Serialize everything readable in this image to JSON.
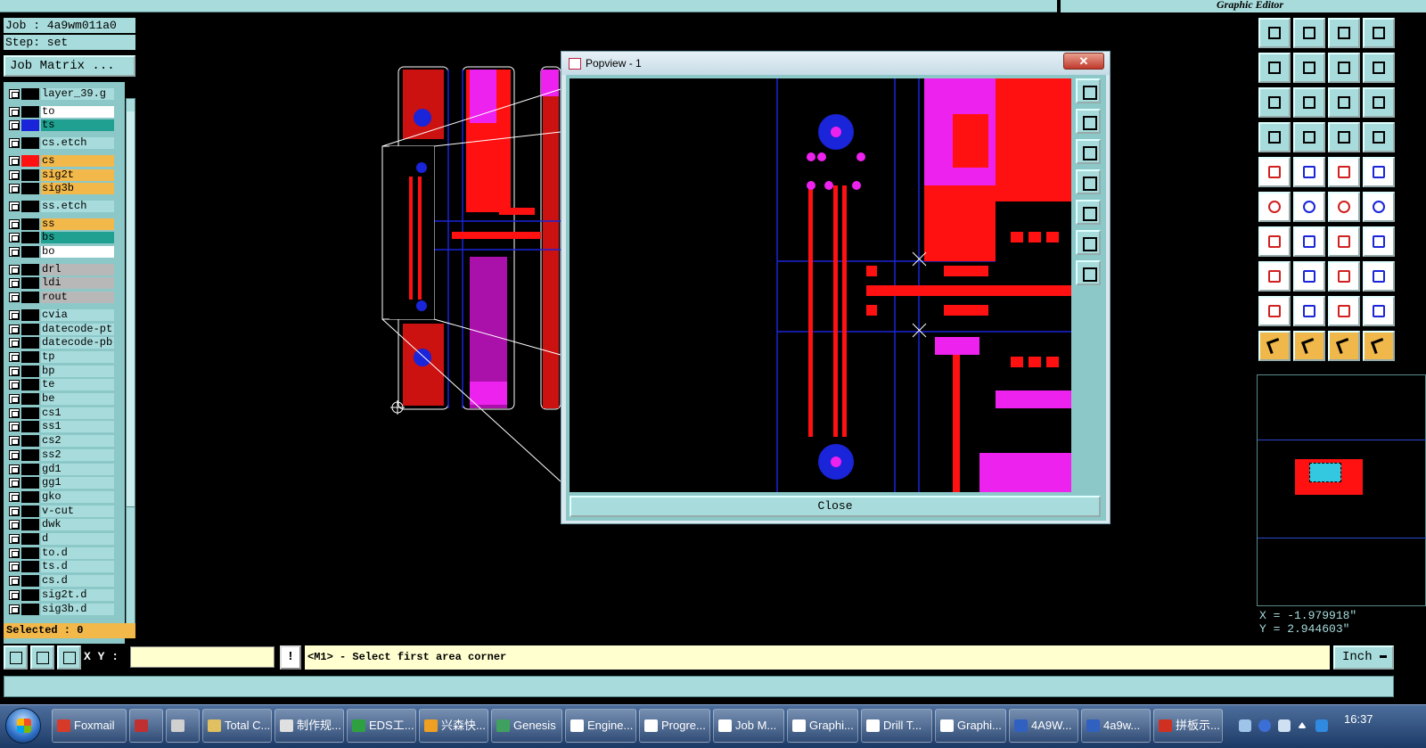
{
  "title_right": "Graphic Editor",
  "job_line": "Job : 4a9wm011a0",
  "step_line": "Step: set",
  "job_matrix_label": "Job Matrix ...",
  "layers": [
    {
      "name": "layer_39.g",
      "color": "#000000",
      "text_bg": "#a8dcdc"
    },
    {
      "name": "to",
      "color": "#000000",
      "text_bg": "#ffffff"
    },
    {
      "name": "ts",
      "color": "#1a24d8",
      "text_bg": "#1fa090"
    },
    {
      "name": "cs.etch",
      "color": "#000000",
      "text_bg": "#a8dcdc"
    },
    {
      "name": "cs",
      "color": "#ff1111",
      "text_bg": "#f2b84a"
    },
    {
      "name": "sig2t",
      "color": "#000000",
      "text_bg": "#f2b84a"
    },
    {
      "name": "sig3b",
      "color": "#000000",
      "text_bg": "#f2b84a"
    },
    {
      "name": "ss.etch",
      "color": "#000000",
      "text_bg": "#a8dcdc"
    },
    {
      "name": "ss",
      "color": "#000000",
      "text_bg": "#f2b84a"
    },
    {
      "name": "bs",
      "color": "#000000",
      "text_bg": "#1fa090"
    },
    {
      "name": "bo",
      "color": "#000000",
      "text_bg": "#ffffff"
    },
    {
      "name": "drl",
      "color": "#000000",
      "text_bg": "#b8b8b8"
    },
    {
      "name": "ldi",
      "color": "#000000",
      "text_bg": "#b8b8b8"
    },
    {
      "name": "rout",
      "color": "#000000",
      "text_bg": "#b8b8b8"
    },
    {
      "name": "cvia",
      "color": "#000000",
      "text_bg": "#a8dcdc"
    },
    {
      "name": "datecode-pt",
      "color": "#000000",
      "text_bg": "#a8dcdc"
    },
    {
      "name": "datecode-pb",
      "color": "#000000",
      "text_bg": "#a8dcdc"
    },
    {
      "name": "tp",
      "color": "#000000",
      "text_bg": "#a8dcdc"
    },
    {
      "name": "bp",
      "color": "#000000",
      "text_bg": "#a8dcdc"
    },
    {
      "name": "te",
      "color": "#000000",
      "text_bg": "#a8dcdc"
    },
    {
      "name": "be",
      "color": "#000000",
      "text_bg": "#a8dcdc"
    },
    {
      "name": "cs1",
      "color": "#000000",
      "text_bg": "#a8dcdc"
    },
    {
      "name": "ss1",
      "color": "#000000",
      "text_bg": "#a8dcdc"
    },
    {
      "name": "cs2",
      "color": "#000000",
      "text_bg": "#a8dcdc"
    },
    {
      "name": "ss2",
      "color": "#000000",
      "text_bg": "#a8dcdc"
    },
    {
      "name": "gd1",
      "color": "#000000",
      "text_bg": "#a8dcdc"
    },
    {
      "name": "gg1",
      "color": "#000000",
      "text_bg": "#a8dcdc"
    },
    {
      "name": "gko",
      "color": "#000000",
      "text_bg": "#a8dcdc"
    },
    {
      "name": "v-cut",
      "color": "#000000",
      "text_bg": "#a8dcdc"
    },
    {
      "name": "dwk",
      "color": "#000000",
      "text_bg": "#a8dcdc"
    },
    {
      "name": "d",
      "color": "#000000",
      "text_bg": "#a8dcdc"
    },
    {
      "name": "to.d",
      "color": "#000000",
      "text_bg": "#a8dcdc"
    },
    {
      "name": "ts.d",
      "color": "#000000",
      "text_bg": "#a8dcdc"
    },
    {
      "name": "cs.d",
      "color": "#000000",
      "text_bg": "#a8dcdc"
    },
    {
      "name": "sig2t.d",
      "color": "#000000",
      "text_bg": "#a8dcdc"
    },
    {
      "name": "sig3b.d",
      "color": "#000000",
      "text_bg": "#a8dcdc"
    }
  ],
  "selected_label": "Selected : 0",
  "popview": {
    "title": "Popview - 1",
    "close_x": "✕",
    "close_label": "Close"
  },
  "coords": {
    "x": "X = -1.979918\"",
    "y": "Y = 2.944603\""
  },
  "status": {
    "xy_label": "X Y :",
    "xy_value": "",
    "bang": "!",
    "prompt": "<M1> - Select first area corner",
    "unit": "Inch"
  },
  "taskbar": {
    "items": [
      {
        "label": "Foxmail",
        "icon_color": "#d83a2a"
      },
      {
        "label": "",
        "icon_color": "#c03030"
      },
      {
        "label": "",
        "icon_color": "#d0d0d0"
      },
      {
        "label": "Total C...",
        "icon_color": "#e0c060"
      },
      {
        "label": "制作规...",
        "icon_color": "#e0e0e0"
      },
      {
        "label": "EDS工...",
        "icon_color": "#2fa040"
      },
      {
        "label": "兴森快...",
        "icon_color": "#f0a020"
      },
      {
        "label": "Genesis",
        "icon_color": "#40a060"
      },
      {
        "label": "Engine...",
        "icon_color": "#ffffff"
      },
      {
        "label": "Progre...",
        "icon_color": "#ffffff"
      },
      {
        "label": "Job M...",
        "icon_color": "#ffffff"
      },
      {
        "label": "Graphi...",
        "icon_color": "#ffffff"
      },
      {
        "label": "Drill T...",
        "icon_color": "#ffffff"
      },
      {
        "label": "Graphi...",
        "icon_color": "#ffffff"
      },
      {
        "label": "4A9W...",
        "icon_color": "#3060c0"
      },
      {
        "label": "4a9w...",
        "icon_color": "#3060c0"
      },
      {
        "label": "拼板示...",
        "icon_color": "#d03020"
      }
    ],
    "clock": "16:37"
  }
}
